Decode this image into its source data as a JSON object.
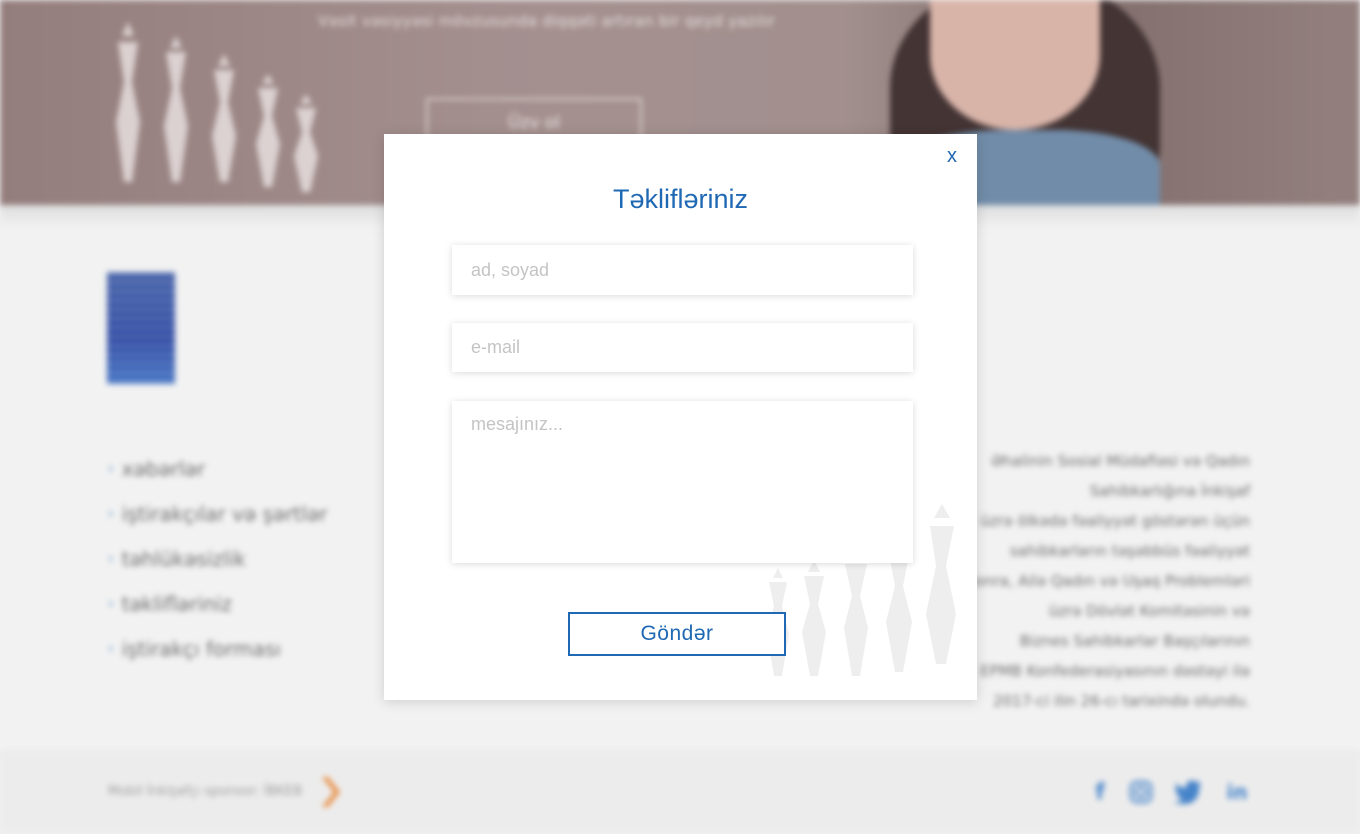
{
  "background": {
    "hero_text": "Vəsit vəsiyyəsi mövzusunda diqqəti artıran bir qeyd yazılır",
    "hero_button": "Üzv ol",
    "nav_items": [
      {
        "label": "xəbərlər"
      },
      {
        "label": "iştirakçılar və şərtlər"
      },
      {
        "label": "təhlükəsizlik"
      },
      {
        "label": "təklifləriniz"
      },
      {
        "label": "iştirakçı forması"
      }
    ],
    "body_lines": [
      "Əhalinin Sosial Müdafiəsi və Qadın Sahibkarlığına İnkişaf",
      "üzrə ölkədə fəaliyyət göstərən üçün",
      "sahibkarların təşəbbüs fəaliyyət",
      "sonra, Ailə Qadın və Uşaq Problemləri",
      "üzrə Dövlət Komitəsinin və",
      "Biznes Sahibkarlar Başçılarının",
      "EPMB Konfederasiyasının dəstəyi ilə",
      "2017-ci ilin 26-cı tarixində olundu."
    ],
    "footer_text": "Mobil İnkişafçı sponsor: İBKEB",
    "colors": {
      "accent": "#1f68b3",
      "footer_accent": "#e88a3c"
    }
  },
  "modal": {
    "close_label": "x",
    "title": "Təklifləriniz",
    "name_placeholder": "ad, soyad",
    "email_placeholder": "e-mail",
    "message_placeholder": "mesajınız...",
    "submit_label": "Göndər"
  }
}
